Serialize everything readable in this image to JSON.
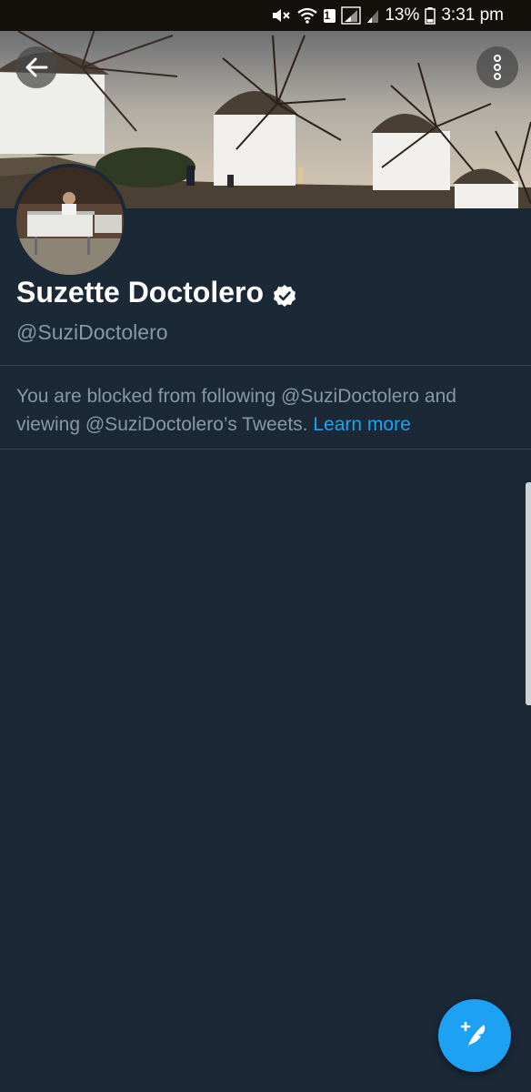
{
  "status_bar": {
    "sim_label": "1",
    "battery": "13%",
    "time": "3:31 pm",
    "icons": [
      "mute-icon",
      "wifi-icon",
      "sim-icon",
      "signal-icon",
      "signal-weak-icon",
      "battery-icon"
    ]
  },
  "header": {
    "back_icon": "arrow-left-icon",
    "more_icon": "more-vertical-icon"
  },
  "profile": {
    "display_name": "Suzette Doctolero",
    "verified": true,
    "handle": "@SuziDoctolero"
  },
  "blocked_notice": {
    "message": "You are blocked from following @SuziDoctolero and viewing @SuziDoctolero’s Tweets.",
    "link_label": "Learn more"
  },
  "fab": {
    "icon": "compose-tweet-icon"
  },
  "colors": {
    "background": "#1b2836",
    "accent": "#1da1f2",
    "muted_text": "#8899a6",
    "divider": "#38444d"
  }
}
